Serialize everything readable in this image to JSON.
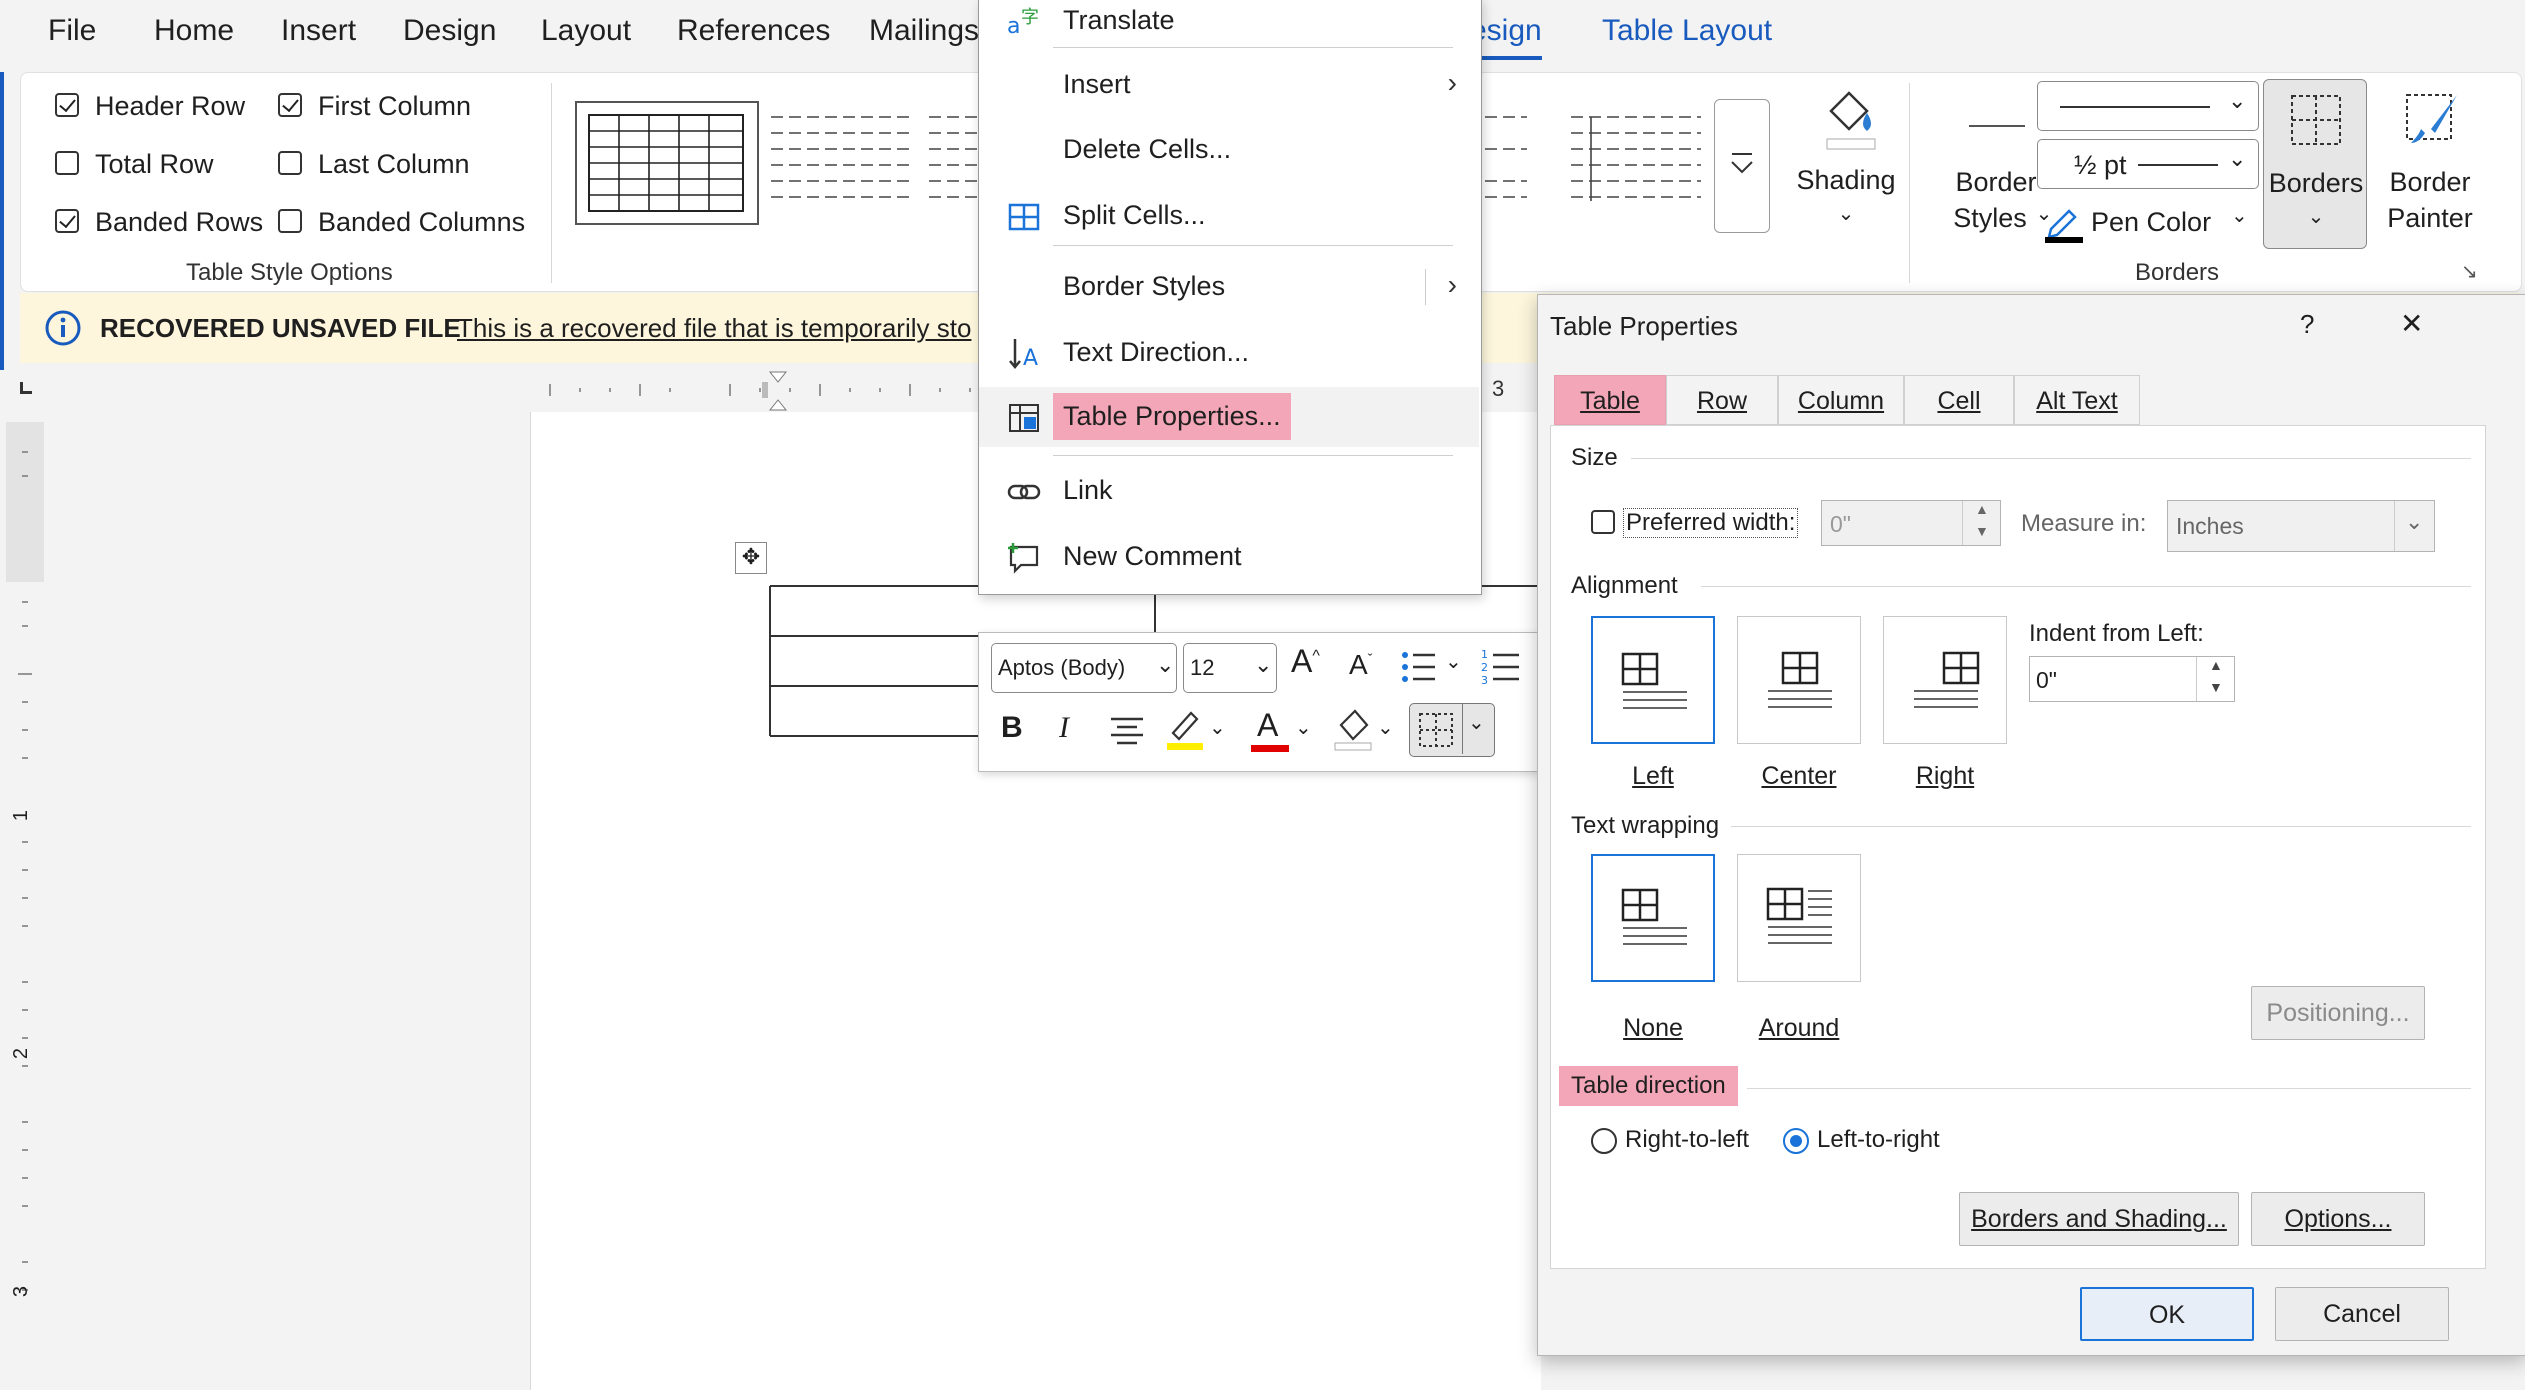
{
  "ribbon_tabs": [
    "File",
    "Home",
    "Insert",
    "Design",
    "Layout",
    "References",
    "Mailings"
  ],
  "context_tabs": {
    "table_design": "esign",
    "table_layout": "Table Layout"
  },
  "table_style_options": {
    "header_row": {
      "label": "Header Row",
      "checked": true
    },
    "first_column": {
      "label": "First Column",
      "checked": true
    },
    "total_row": {
      "label": "Total Row",
      "checked": false
    },
    "last_column": {
      "label": "Last Column",
      "checked": false
    },
    "banded_rows": {
      "label": "Banded Rows",
      "checked": true
    },
    "banded_columns": {
      "label": "Banded Columns",
      "checked": false
    },
    "group_label": "Table Style Options"
  },
  "ribbon_right": {
    "shading": "Shading",
    "border_styles_1": "Border",
    "border_styles_2": "Styles",
    "pen_weight": "½ pt",
    "pen_color": "Pen Color",
    "borders": "Borders",
    "border_painter_1": "Border",
    "border_painter_2": "Painter",
    "group_label": "Borders"
  },
  "infobar": {
    "title": "RECOVERED UNSAVED FILE",
    "message": "This is a recovered file that is temporarily sto"
  },
  "ruler_number": "3",
  "vruler_numbers": [
    "1",
    "2",
    "3"
  ],
  "context_menu": {
    "translate": "Translate",
    "insert": "Insert",
    "delete_cells": "Delete Cells...",
    "split_cells": "Split Cells...",
    "border_styles": "Border Styles",
    "text_direction": "Text Direction...",
    "table_properties": "Table Properties...",
    "link": "Link",
    "new_comment": "New Comment"
  },
  "mini_toolbar": {
    "font": "Aptos (Body)",
    "size": "12",
    "bold": "B",
    "italic": "I",
    "grow": "A",
    "shrink": "A",
    "font_color_letter": "A"
  },
  "dialog": {
    "title": "Table Properties",
    "help": "?",
    "close": "✕",
    "tabs": [
      "Table",
      "Row",
      "Column",
      "Cell",
      "Alt Text"
    ],
    "size_section": "Size",
    "preferred_width_label": "Preferred width:",
    "preferred_width_checked": false,
    "preferred_width_value": "0\"",
    "measure_in_label": "Measure in:",
    "measure_in_value": "Inches",
    "alignment_section": "Alignment",
    "alignment_options": [
      "Left",
      "Center",
      "Right"
    ],
    "alignment_selected": "Left",
    "indent_label": "Indent from Left:",
    "indent_value": "0\"",
    "text_wrapping_section": "Text wrapping",
    "wrapping_options": [
      "None",
      "Around"
    ],
    "wrapping_selected": "None",
    "positioning_button": "Positioning...",
    "table_direction_section": "Table direction",
    "direction_rtl": "Right-to-left",
    "direction_ltr": "Left-to-right",
    "direction_selected": "Left-to-right",
    "borders_shading_button": "Borders and Shading...",
    "options_button": "Options...",
    "ok_button": "OK",
    "cancel_button": "Cancel"
  },
  "colors": {
    "accent_blue": "#185abd",
    "highlight_pink": "#f3a6b7",
    "infobar_bg": "#fdf6dc",
    "pen_color": "#000000",
    "font_color_red": "#e00000",
    "highlight_yellow": "#ffee00"
  }
}
